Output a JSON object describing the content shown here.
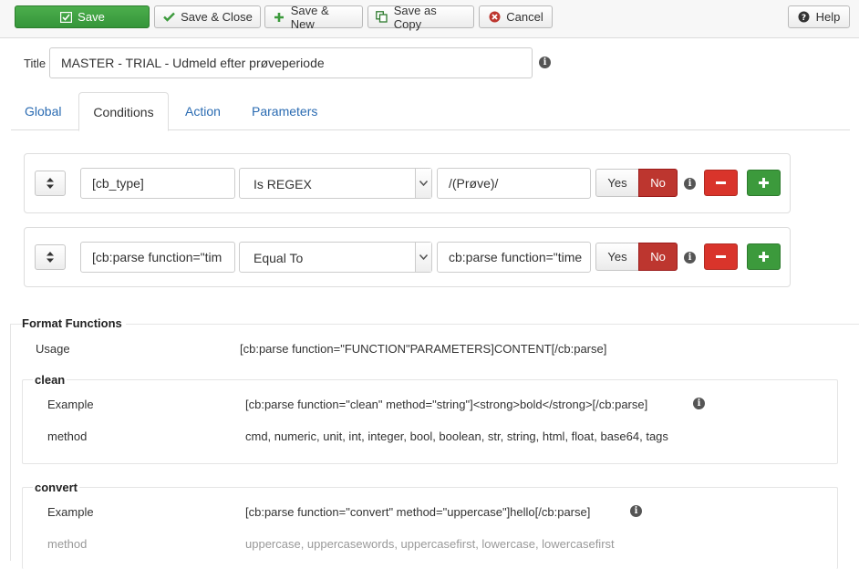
{
  "toolbar": {
    "save": "Save",
    "save_close": "Save & Close",
    "save_new": "Save & New",
    "save_copy": "Save as Copy",
    "cancel": "Cancel",
    "help": "Help"
  },
  "title": {
    "label": "Title",
    "value": "MASTER - TRIAL - Udmeld efter prøveperiode"
  },
  "tabs": [
    {
      "label": "Global"
    },
    {
      "label": "Conditions"
    },
    {
      "label": "Action"
    },
    {
      "label": "Parameters"
    }
  ],
  "conditions": [
    {
      "field": "[cb_type]",
      "operator": "Is REGEX",
      "value": "/(Prøve)/",
      "yes": "Yes",
      "no": "No"
    },
    {
      "field": "[cb:parse function=\"tim",
      "operator": "Equal To",
      "value": "cb:parse function=\"time",
      "yes": "Yes",
      "no": "No"
    }
  ],
  "format_functions": {
    "title": "Format Functions",
    "usage_label": "Usage",
    "usage_value": "[cb:parse function=\"FUNCTION\"PARAMETERS]CONTENT[/cb:parse]",
    "sections": [
      {
        "title": "clean",
        "example_label": "Example",
        "example_value": "[cb:parse function=\"clean\" method=\"string\"]<strong>bold</strong>[/cb:parse]",
        "method_label": "method",
        "method_value": "cmd, numeric, unit, int, integer, bool, boolean, str, string, html, float, base64, tags"
      },
      {
        "title": "convert",
        "example_label": "Example",
        "example_value": "[cb:parse function=\"convert\" method=\"uppercase\"]hello[/cb:parse]",
        "method_label": "method",
        "method_value": "uppercase, uppercasewords, uppercasefirst, lowercase, lowercasefirst"
      }
    ]
  },
  "colors": {
    "success": "#3c9a3c",
    "danger": "#bd362f",
    "link": "#2a6bb2"
  }
}
